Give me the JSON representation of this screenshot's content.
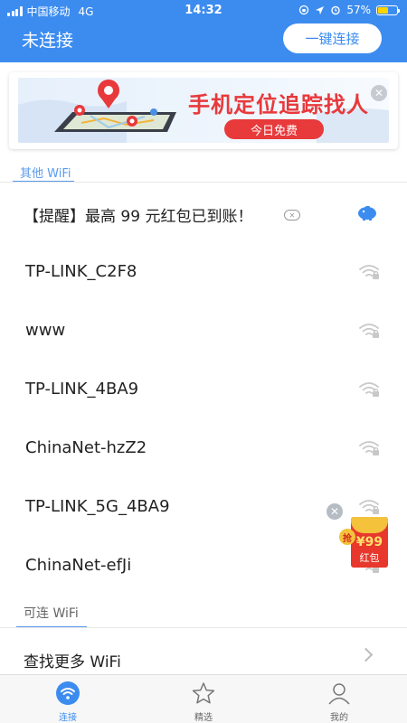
{
  "status_bar": {
    "carrier": "中国移动",
    "network": "4G",
    "time": "14:32",
    "battery": "57%",
    "battery_level": 0.57
  },
  "header": {
    "title": "未连接",
    "connect_button": "一键连接"
  },
  "banner": {
    "title": "手机定位追踪找人",
    "button": "今日免费",
    "close_icon": "close-icon"
  },
  "sections": {
    "other_wifi": "其他 WiFi",
    "available_wifi": "可连 WiFi"
  },
  "promo": {
    "text": "【提醒】最高 99 元红包已到账！",
    "icon": "piggy-bank-icon"
  },
  "wifi_list": [
    {
      "name": "TP-LINK_C2F8",
      "icon": "wifi-locked-icon"
    },
    {
      "name": "www",
      "icon": "wifi-locked-icon"
    },
    {
      "name": "TP-LINK_4BA9",
      "icon": "wifi-locked-icon"
    },
    {
      "name": "ChinaNet-hzZ2",
      "icon": "wifi-locked-icon"
    },
    {
      "name": "TP-LINK_5G_4BA9",
      "icon": "wifi-locked-icon"
    },
    {
      "name": "ChinaNet-efJi",
      "icon": "wifi-locked-icon"
    }
  ],
  "more": {
    "label": "查找更多 WiFi"
  },
  "red_packet": {
    "grab": "抢",
    "amount": "¥99",
    "label": "红包"
  },
  "tabs": [
    {
      "label": "连接",
      "icon": "wifi-icon",
      "active": true
    },
    {
      "label": "精选",
      "icon": "star-icon",
      "active": false
    },
    {
      "label": "我的",
      "icon": "user-icon",
      "active": false
    }
  ],
  "colors": {
    "primary": "#3c8cf0",
    "accent_red": "#e8393b",
    "battery": "#ffd400"
  }
}
